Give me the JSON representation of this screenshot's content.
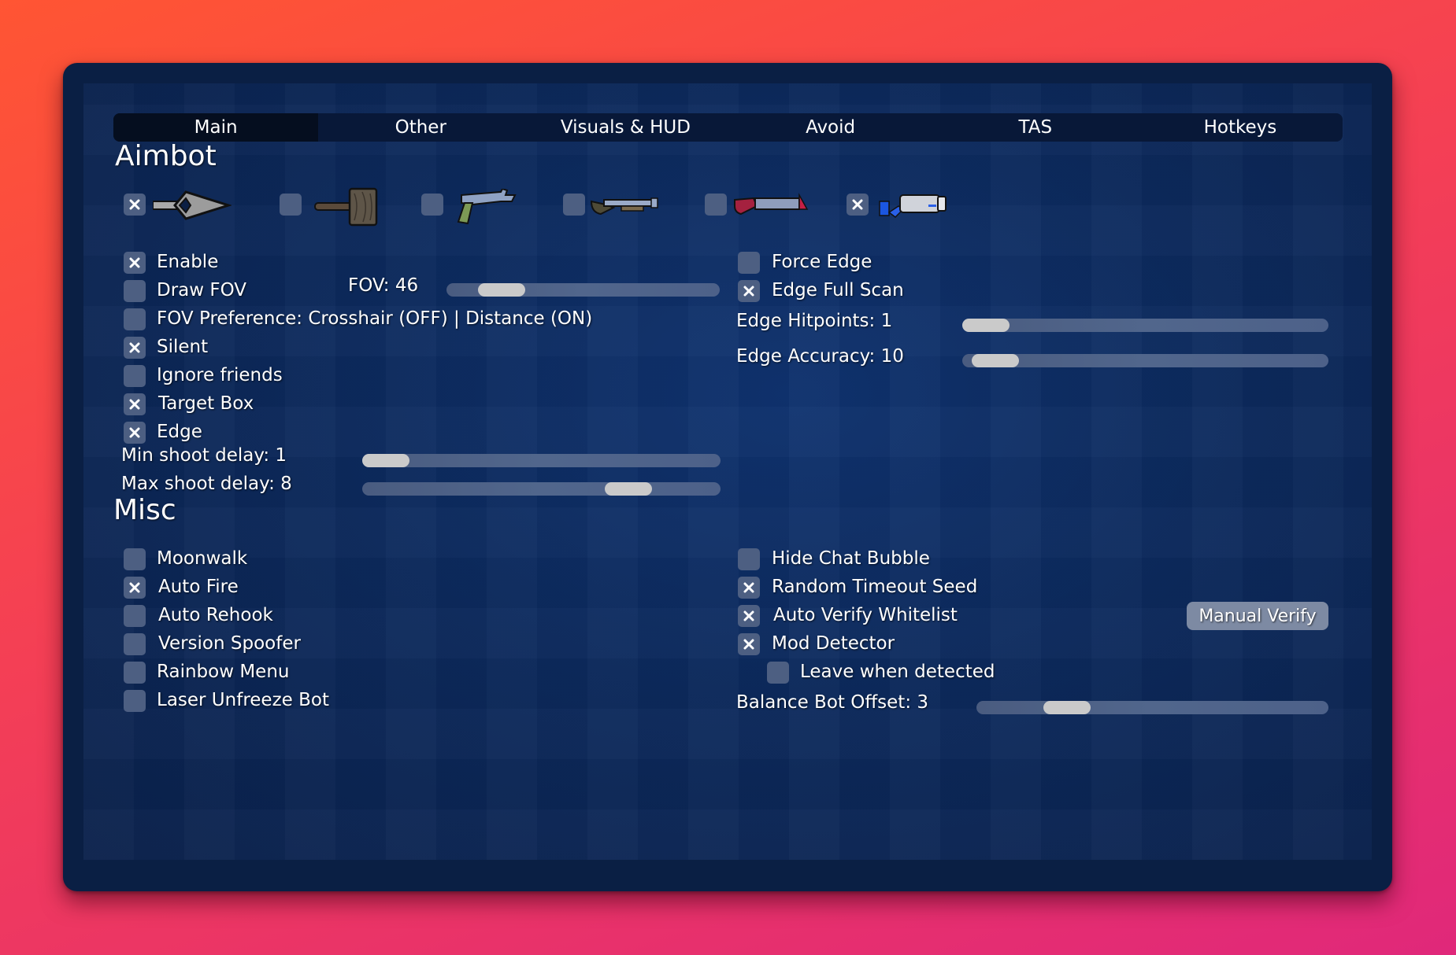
{
  "tabs": [
    {
      "label": "Main",
      "active": true
    },
    {
      "label": "Other",
      "active": false
    },
    {
      "label": "Visuals & HUD",
      "active": false
    },
    {
      "label": "Avoid",
      "active": false
    },
    {
      "label": "TAS",
      "active": false
    },
    {
      "label": "Hotkeys",
      "active": false
    }
  ],
  "aimbot": {
    "heading": "Aimbot",
    "weapons": [
      {
        "name": "spear",
        "checked": true
      },
      {
        "name": "hammer",
        "checked": false
      },
      {
        "name": "pistol",
        "checked": false
      },
      {
        "name": "shotgun",
        "checked": false
      },
      {
        "name": "grenade-launcher",
        "checked": false
      },
      {
        "name": "laser-rifle",
        "checked": true
      }
    ],
    "left_options": [
      {
        "label": "Enable",
        "checked": true
      },
      {
        "label": "Draw FOV",
        "checked": false
      },
      {
        "label": "FOV Preference: Crosshair (OFF) | Distance (ON)",
        "checked": false
      },
      {
        "label": "Silent",
        "checked": true
      },
      {
        "label": "Ignore friends",
        "checked": false
      },
      {
        "label": "Target Box",
        "checked": true
      },
      {
        "label": "Edge",
        "checked": true
      }
    ],
    "fov_slider": {
      "label": "FOV: 46",
      "value": 46,
      "fraction": 0.14
    },
    "min_shoot_delay": {
      "label": "Min shoot delay: 1",
      "value": 1,
      "fraction": 0.0
    },
    "max_shoot_delay": {
      "label": "Max shoot delay: 8",
      "value": 8,
      "fraction": 0.78
    },
    "right_options": [
      {
        "label": "Force Edge",
        "checked": false
      },
      {
        "label": "Edge Full Scan",
        "checked": true
      }
    ],
    "edge_hitpoints": {
      "label": "Edge Hitpoints: 1",
      "value": 1,
      "fraction": 0.0
    },
    "edge_accuracy": {
      "label": "Edge Accuracy: 10",
      "value": 10,
      "fraction": 0.03
    }
  },
  "misc": {
    "heading": "Misc",
    "left_options": [
      {
        "label": "Moonwalk",
        "checked": false
      },
      {
        "label": "Auto Fire",
        "checked": true
      },
      {
        "label": "Auto Rehook",
        "checked": false
      },
      {
        "label": "Version Spoofer",
        "checked": false
      },
      {
        "label": "Rainbow Menu",
        "checked": false
      },
      {
        "label": "Laser Unfreeze Bot",
        "checked": false
      }
    ],
    "right_options": [
      {
        "label": "Hide Chat Bubble",
        "checked": false
      },
      {
        "label": "Random Timeout Seed",
        "checked": true
      },
      {
        "label": "Auto Verify Whitelist",
        "checked": true
      },
      {
        "label": "Mod Detector",
        "checked": true
      }
    ],
    "sub_option": {
      "label": "Leave when detected",
      "checked": false
    },
    "manual_verify_label": "Manual Verify",
    "balance_bot_offset": {
      "label": "Balance Bot Offset: 3",
      "value": 3,
      "fraction": 0.22
    }
  },
  "colors": {
    "checkbox": "#4d5f82",
    "slider_track": "#4d6189",
    "slider_thumb": "#cacaca",
    "panel": "#0a1f44",
    "active_tab": "#050e1f"
  }
}
